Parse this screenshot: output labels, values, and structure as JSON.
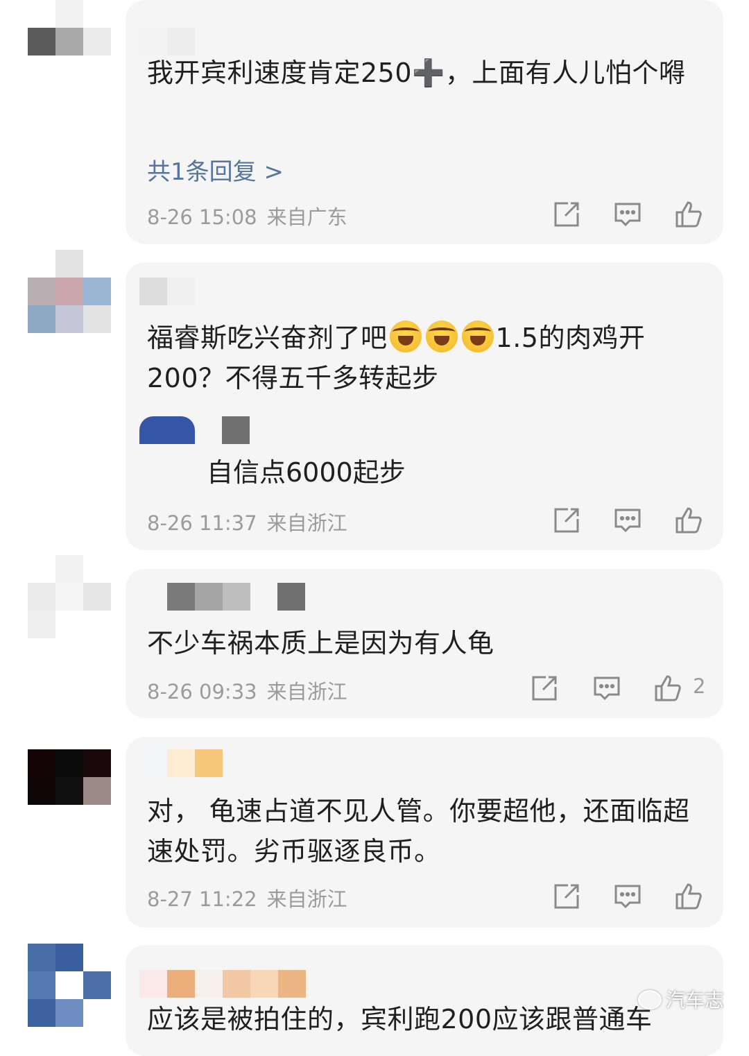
{
  "colors": {
    "card_bg": "#f5f5f5",
    "link": "#55749e",
    "meta": "#9b9b9b",
    "icon": "#8a8a8a"
  },
  "comments": [
    {
      "text": "我开宾利速度肯定250➕，上面有人儿怕个嘚",
      "reply_link": "共1条回复 >",
      "date": "8-26 15:08",
      "location": "来自广东",
      "likes": ""
    },
    {
      "text_before": "福睿斯吃兴奋剂了吧",
      "emoji_name": "laughing-crying-emoji",
      "text_after": "1.5的肉鸡开200？不得五千多转起步",
      "reply_text": "自信点6000起步",
      "date": "8-26 11:37",
      "location": "来自浙江",
      "likes": ""
    },
    {
      "text": "不少车祸本质上是因为有人龟",
      "date": "8-26 09:33",
      "location": "来自浙江",
      "likes": "2"
    },
    {
      "text": "对， 龟速占道不见人管。你要超他，还面临超速处罚。劣币驱逐良币。",
      "date": "8-27 11:22",
      "location": "来自浙江",
      "likes": ""
    },
    {
      "text": "应该是被拍住的，宾利跑200应该跟普通车"
    }
  ],
  "watermark": "汽车志",
  "icons": [
    "share-icon",
    "comment-icon",
    "like-icon"
  ]
}
